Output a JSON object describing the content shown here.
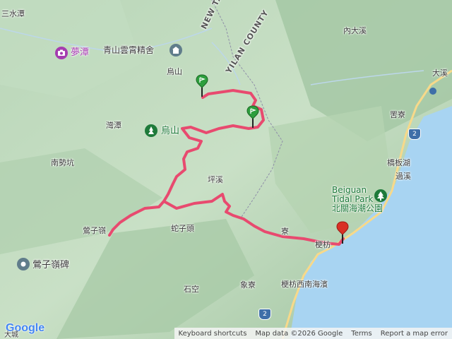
{
  "map": {
    "labels": {
      "sanshuitan": "三水潭",
      "mengtan": "夢潭",
      "qingshan_lodge": "青山雲霄精舍",
      "new_taipei_city": "NEW TAIPEI CITY",
      "yilan_county": "YILAN COUNTY",
      "wushan": "烏山",
      "wantan": "灣潭",
      "wushan_trail": "烏山",
      "nanshikeng": "南勢坑",
      "pingxi": "坪溪",
      "yingzi_ridge": "鶯子嶺",
      "shezitou": "蛇子頭",
      "yingzi_ling_monument": "鶯子嶺碑",
      "dashuanggui": "大溪",
      "neidaxi": "內大溪",
      "daxi": "大溪",
      "guiliao": "罟寮",
      "jubanhu": "橋板湖",
      "guoxi": "過溪",
      "beiguan_en_1": "Beiguan",
      "beiguan_en_2": "Tidal Park",
      "beiguan_zh": "北關海潮公園",
      "shiliao": "寮",
      "gengfang": "梗枋",
      "shikong": "石空",
      "xiangliao": "象寮",
      "gengfang_beach": "梗枋西南海濱",
      "dacheng": "大城"
    },
    "route_shields": [
      "2",
      "2"
    ],
    "route_color": "#e84a6f",
    "water_color": "#a8d4f2",
    "pin_green": "#2e9e3e",
    "pin_red": "#d93025"
  },
  "footer": {
    "logo": "Google",
    "keyboard": "Keyboard shortcuts",
    "map_data": "Map data ©2026 Google",
    "terms": "Terms",
    "report": "Report a map error"
  }
}
